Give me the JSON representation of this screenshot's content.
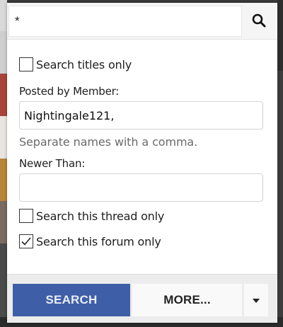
{
  "search": {
    "query": "*",
    "button_icon": "search-icon"
  },
  "options": {
    "titles_only": {
      "label": "Search titles only",
      "checked": false
    },
    "posted_by_label": "Posted by Member:",
    "posted_by_value": "Nightingale121,",
    "posted_by_hint": "Separate names with a comma.",
    "newer_than_label": "Newer Than:",
    "newer_than_value": "",
    "thread_only": {
      "label": "Search this thread only",
      "checked": false
    },
    "forum_only": {
      "label": "Search this forum only",
      "checked": true
    }
  },
  "footer": {
    "search_label": "SEARCH",
    "more_label": "MORE...",
    "caret_icon": "caret-down-icon"
  },
  "colors": {
    "primary_button": "#3f5ea8",
    "footer_bg": "#ececec"
  }
}
